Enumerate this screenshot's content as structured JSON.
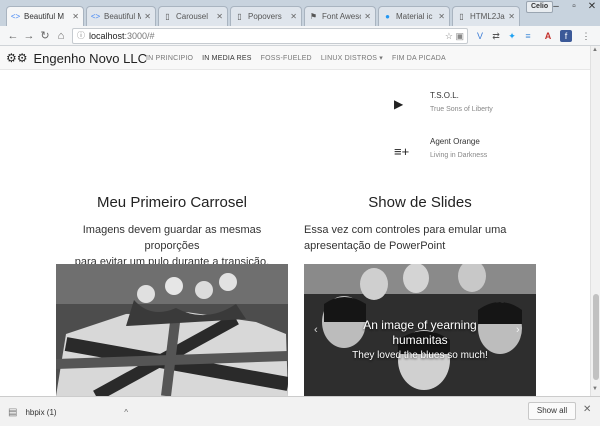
{
  "browser": {
    "tabs": [
      {
        "title": "Beautiful M",
        "icon": "angle-brackets-icon",
        "active": true
      },
      {
        "title": "Beautiful M",
        "icon": "angle-brackets-icon",
        "active": false
      },
      {
        "title": "Carousel",
        "icon": "page-icon",
        "active": false
      },
      {
        "title": "Popovers",
        "icon": "page-icon",
        "active": false
      },
      {
        "title": "Font Aweso",
        "icon": "flag-icon",
        "active": false
      },
      {
        "title": "Material ic",
        "icon": "material-icon",
        "active": false
      },
      {
        "title": "HTML2Jade",
        "icon": "page-icon",
        "active": false
      }
    ],
    "user": "Celio",
    "url_host": "localhost",
    "url_rest": ":3000/#",
    "accent": "#4285f4"
  },
  "navbar": {
    "brand": "Engenho Novo LLC",
    "links": [
      "IN PRINCIPIO",
      "IN MEDIA RES",
      "FOSS-FUELED",
      "LINUX DISTROS ▾",
      "FIM DA PICADA"
    ]
  },
  "media": [
    {
      "icon": "play-icon",
      "title": "T.S.O.L.",
      "subtitle": "True Sons of Liberty"
    },
    {
      "icon": "playlist-add-icon",
      "title": "Agent Orange",
      "subtitle": "Living in Darkness"
    }
  ],
  "left_column": {
    "title": "Meu Primeiro Carrosel",
    "text_line1": "Imagens devem guardar as mesmas proporções",
    "text_line2": "para evitar um pulo durante a transição."
  },
  "right_column": {
    "title": "Show de Slides",
    "text_line1": "Essa vez com controles para emular uma",
    "text_line2": "apresentação de PowerPoint",
    "caption_title": "An image of yearning humanitas",
    "caption_text": "They loved the blues so much!"
  },
  "downloads": {
    "file": "hbpix (1)",
    "show_all": "Show all"
  }
}
